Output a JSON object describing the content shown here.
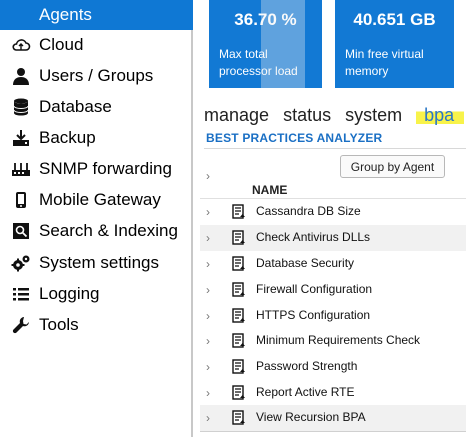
{
  "sidebar": {
    "items": [
      {
        "label": "Agents",
        "icon": "agents-icon",
        "active": true
      },
      {
        "label": "Cloud",
        "icon": "cloud-icon"
      },
      {
        "label": "Users / Groups",
        "icon": "user-icon"
      },
      {
        "label": "Database",
        "icon": "database-icon"
      },
      {
        "label": "Backup",
        "icon": "backup-icon"
      },
      {
        "label": "SNMP forwarding",
        "icon": "snmp-icon"
      },
      {
        "label": "Mobile Gateway",
        "icon": "mobile-icon"
      },
      {
        "label": "Search & Indexing",
        "icon": "search-icon"
      },
      {
        "label": "System settings",
        "icon": "gears-icon"
      },
      {
        "label": "Logging",
        "icon": "list-icon"
      },
      {
        "label": "Tools",
        "icon": "wrench-icon"
      }
    ]
  },
  "tiles": [
    {
      "value": "36.70 %",
      "caption_line1": "Max total",
      "caption_line2": "processor load"
    },
    {
      "value": "40.651 GB",
      "caption_line1": "Min free virtual",
      "caption_line2": "memory"
    }
  ],
  "tabs": [
    "manage",
    "status",
    "system",
    "bpa"
  ],
  "section_title": "BEST PRACTICES ANALYZER",
  "group_button": "Group by Agent",
  "column_header": "NAME",
  "rows": [
    "Cassandra DB Size",
    "Check Antivirus DLLs",
    "Database Security",
    "Firewall Configuration",
    "HTTPS Configuration",
    "Minimum Requirements Check",
    "Password Strength",
    "Report Active RTE",
    "View Recursion BPA"
  ],
  "colors": {
    "accent": "#0f78d4",
    "tile": "#1279d4",
    "section_title": "#1a6fc4",
    "highlight": "#f8f34a"
  }
}
